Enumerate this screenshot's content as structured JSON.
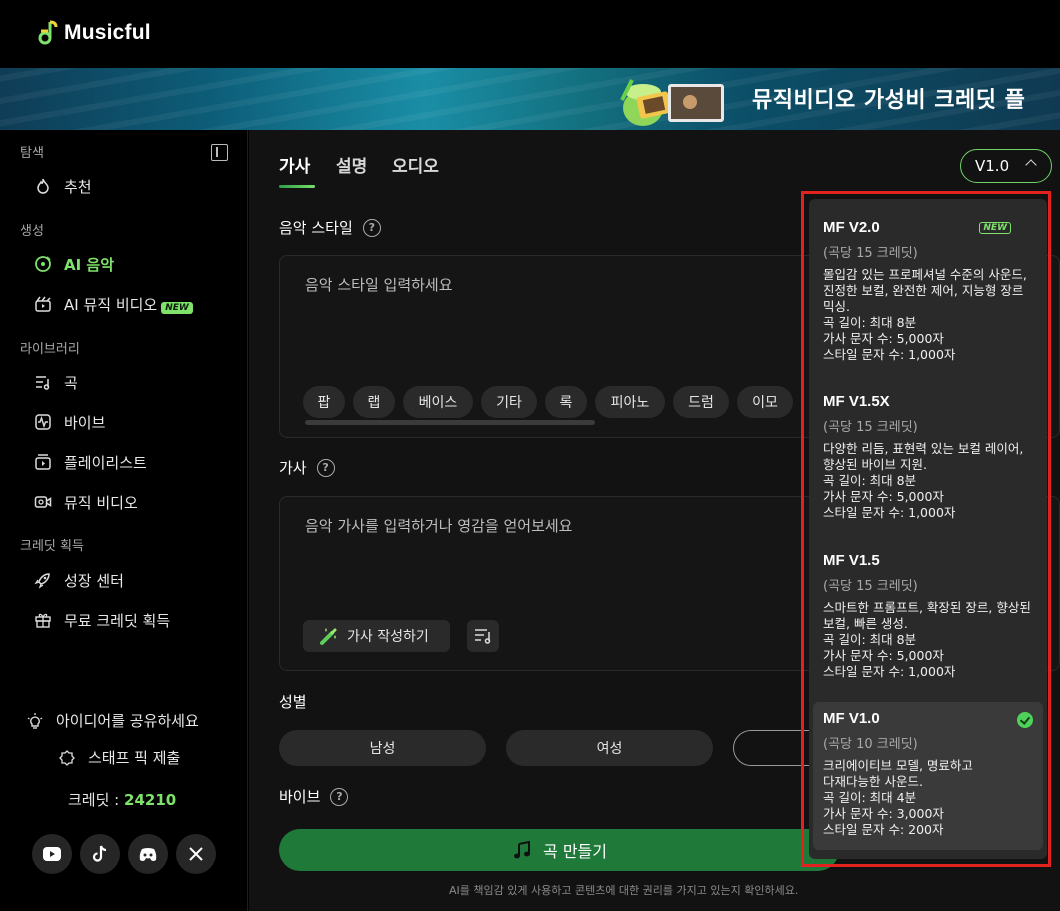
{
  "app": {
    "name": "Musicful"
  },
  "banner": {
    "text": "뮤직비디오 가성비 크레딧 플"
  },
  "sidebar": {
    "sections": [
      {
        "label": "탐색",
        "items": [
          {
            "label": "추천",
            "icon": "flame-icon"
          }
        ]
      },
      {
        "label": "생성",
        "items": [
          {
            "label": "AI 음악",
            "icon": "music-disc-icon",
            "active": true
          },
          {
            "label": "AI 뮤직 비디오",
            "icon": "video-clapper-icon",
            "badge": "NEW"
          }
        ]
      },
      {
        "label": "라이브러리",
        "items": [
          {
            "label": "곡",
            "icon": "song-list-icon"
          },
          {
            "label": "바이브",
            "icon": "waveform-icon"
          },
          {
            "label": "플레이리스트",
            "icon": "playlist-icon"
          },
          {
            "label": "뮤직 비디오",
            "icon": "video-camera-icon"
          }
        ]
      },
      {
        "label": "크레딧 획득",
        "items": [
          {
            "label": "성장 센터",
            "icon": "rocket-icon"
          },
          {
            "label": "무료 크레딧 획득",
            "icon": "gift-icon"
          }
        ]
      }
    ],
    "share_ideas": "아이디어를 공유하세요",
    "submit_pick": "스태프 픽 제출",
    "credits_label": "크레딧 :",
    "credits_value": "24210",
    "social": [
      "youtube-icon",
      "tiktok-icon",
      "discord-icon",
      "x-icon"
    ]
  },
  "tabs": [
    "가사",
    "설명",
    "오디오"
  ],
  "version_selector": {
    "value": "V1.0"
  },
  "style_field": {
    "label": "음악 스타일",
    "placeholder": "음악 스타일 입력하세요",
    "chips": [
      "팝",
      "랩",
      "베이스",
      "기타",
      "록",
      "피아노",
      "드럼",
      "이모"
    ]
  },
  "lyrics_field": {
    "label": "가사",
    "placeholder": "음악 가사를 입력하거나 영감을 얻어보세요",
    "write_button": "가사 작성하기"
  },
  "gender": {
    "label": "성별",
    "options": [
      "남성",
      "여성",
      ""
    ]
  },
  "vibe": {
    "label": "바이브"
  },
  "create_button": "곡 만들기",
  "disclaimer": "AI를 책임감 있게 사용하고 콘텐츠에 대한 권리를 가지고 있는지 확인하세요.",
  "versions": [
    {
      "name": "MF V2.0",
      "badge": "NEW",
      "cost": "(곡당 15 크레딧)",
      "desc": "몰입감 있는 프로페셔널 수준의 사운드, 진정한 보컬, 완전한 제어, 지능형 장르 믹싱.",
      "specs": [
        "곡 길이: 최대 8분",
        "가사 문자 수: 5,000자",
        "스타일 문자 수: 1,000자"
      ]
    },
    {
      "name": "MF V1.5X",
      "cost": "(곡당 15 크레딧)",
      "desc": "다양한 리듬, 표현력 있는 보컬 레이어, 향상된 바이브 지원.",
      "specs": [
        "곡 길이: 최대 8분",
        "가사 문자 수: 5,000자",
        "스타일 문자 수: 1,000자"
      ]
    },
    {
      "name": "MF V1.5",
      "cost": "(곡당 15 크레딧)",
      "desc": "스마트한 프롬프트, 확장된 장르, 향상된 보컬, 빠른 생성.",
      "specs": [
        "곡 길이: 최대 8분",
        "가사 문자 수: 5,000자",
        "스타일 문자 수: 1,000자"
      ]
    },
    {
      "name": "MF V1.0",
      "cost": "(곡당 10 크레딧)",
      "selected": true,
      "desc": "크리에이티브 모델, 명료하고 다재다능한 사운드.",
      "specs": [
        "곡 길이: 최대 4분",
        "가사 문자 수: 3,000자",
        "스타일 문자 수: 200자"
      ]
    }
  ],
  "colors": {
    "accent": "#7ee26b",
    "create": "#1f7a3a",
    "highlight": "#e1221f"
  }
}
